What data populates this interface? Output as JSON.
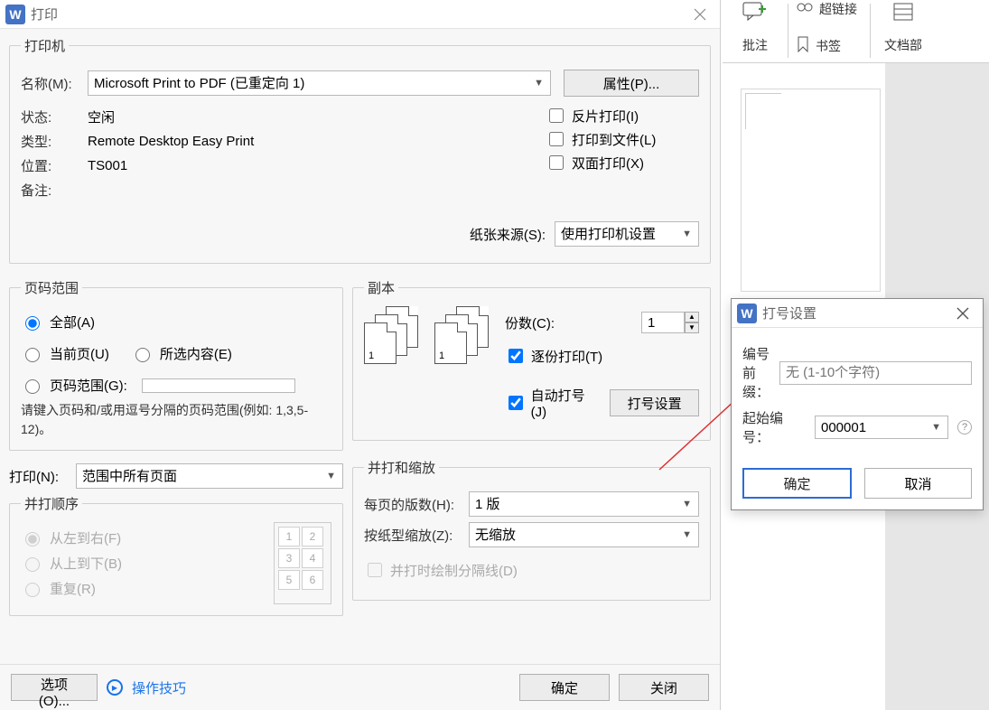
{
  "ribbon": {
    "annotate_label": "批注",
    "hyperlink_label": "超链接",
    "bookmark_label": "书签",
    "docpart_label": "文档部"
  },
  "print": {
    "title": "打印",
    "printer_legend": "打印机",
    "name_label": "名称(M):",
    "name_value": "Microsoft Print to PDF (已重定向 1)",
    "properties_btn": "属性(P)...",
    "status_label": "状态:",
    "status_value": "空闲",
    "type_label": "类型:",
    "type_value": "Remote Desktop Easy Print",
    "location_label": "位置:",
    "location_value": "TS001",
    "remark_label": "备注:",
    "chk_mirror": "反片打印(I)",
    "chk_tofile": "打印到文件(L)",
    "chk_duplex": "双面打印(X)",
    "paper_src_label": "纸张来源(S):",
    "paper_src_value": "使用打印机设置",
    "range_legend": "页码范围",
    "range_all": "全部(A)",
    "range_current": "当前页(U)",
    "range_selection": "所选内容(E)",
    "range_pages": "页码范围(G):",
    "range_hint": "请键入页码和/或用逗号分隔的页码范围(例如: 1,3,5-12)。",
    "print_what_label": "打印(N):",
    "print_what_value": "范围中所有页面",
    "porder_legend": "并打顺序",
    "porder_lr": "从左到右(F)",
    "porder_tb": "从上到下(B)",
    "porder_repeat": "重复(R)",
    "copies_legend": "副本",
    "copies_label": "份数(C):",
    "copies_value": "1",
    "collate_label": "逐份打印(T)",
    "autonum_label": "自动打号(J)",
    "autonum_btn": "打号设置",
    "scale_legend": "并打和缩放",
    "pps_label": "每页的版数(H):",
    "pps_value": "1 版",
    "scale_label": "按纸型缩放(Z):",
    "scale_value": "无缩放",
    "draw_sep_label": "并打时绘制分隔线(D)",
    "options_btn": "选项(O)...",
    "tips_link": "操作技巧",
    "ok_btn": "确定",
    "close_btn": "关闭"
  },
  "sub": {
    "title": "打号设置",
    "prefix_label": "编号前缀：",
    "prefix_placeholder": "无 (1-10个字符)",
    "start_label": "起始编号：",
    "start_value": "000001",
    "ok": "确定",
    "cancel": "取消"
  }
}
